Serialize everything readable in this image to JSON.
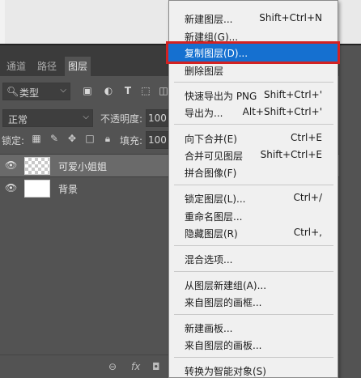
{
  "tabs": [
    "通道",
    "路径",
    "图层"
  ],
  "filter": {
    "kind_label": "类型"
  },
  "blend": {
    "mode": "正常",
    "opacity_label": "不透明度:",
    "opacity_value": "100"
  },
  "lock": {
    "label": "锁定:",
    "fill_label": "填充:",
    "fill_value": "100"
  },
  "layers": [
    {
      "name": "可爱小姐姐",
      "selected": true
    },
    {
      "name": "背景",
      "selected": false
    }
  ],
  "bottom_icons": [
    "link-icon",
    "fx-icon",
    "mask-icon"
  ],
  "bottom_glyphs": {
    "link": "⊖",
    "fx": "fx",
    "mask": "◘"
  },
  "menu": {
    "highlight_color": "#1570d0",
    "outline_color": "#d32222",
    "items": [
      {
        "label": "新建图层...",
        "shortcut": "Shift+Ctrl+N"
      },
      {
        "label": "新建组(G)...",
        "shortcut": ""
      },
      {
        "label": "复制图层(D)...",
        "shortcut": "",
        "highlighted": true
      },
      {
        "label": "删除图层",
        "shortcut": ""
      },
      {
        "label": "快速导出为 PNG",
        "shortcut": "Shift+Ctrl+'"
      },
      {
        "label": "导出为...",
        "shortcut": "Alt+Shift+Ctrl+'"
      },
      {
        "label": "向下合并(E)",
        "shortcut": "Ctrl+E"
      },
      {
        "label": "合并可见图层",
        "shortcut": "Shift+Ctrl+E"
      },
      {
        "label": "拼合图像(F)",
        "shortcut": ""
      },
      {
        "label": "锁定图层(L)...",
        "shortcut": "Ctrl+/"
      },
      {
        "label": "重命名图层...",
        "shortcut": ""
      },
      {
        "label": "隐藏图层(R)",
        "shortcut": "Ctrl+,"
      },
      {
        "label": "混合选项...",
        "shortcut": ""
      },
      {
        "label": "从图层新建组(A)...",
        "shortcut": ""
      },
      {
        "label": "来自图层的画框...",
        "shortcut": ""
      },
      {
        "label": "新建画板...",
        "shortcut": ""
      },
      {
        "label": "来自图层的画板...",
        "shortcut": ""
      },
      {
        "label": "转换为智能对象(S)",
        "shortcut": ""
      }
    ]
  }
}
